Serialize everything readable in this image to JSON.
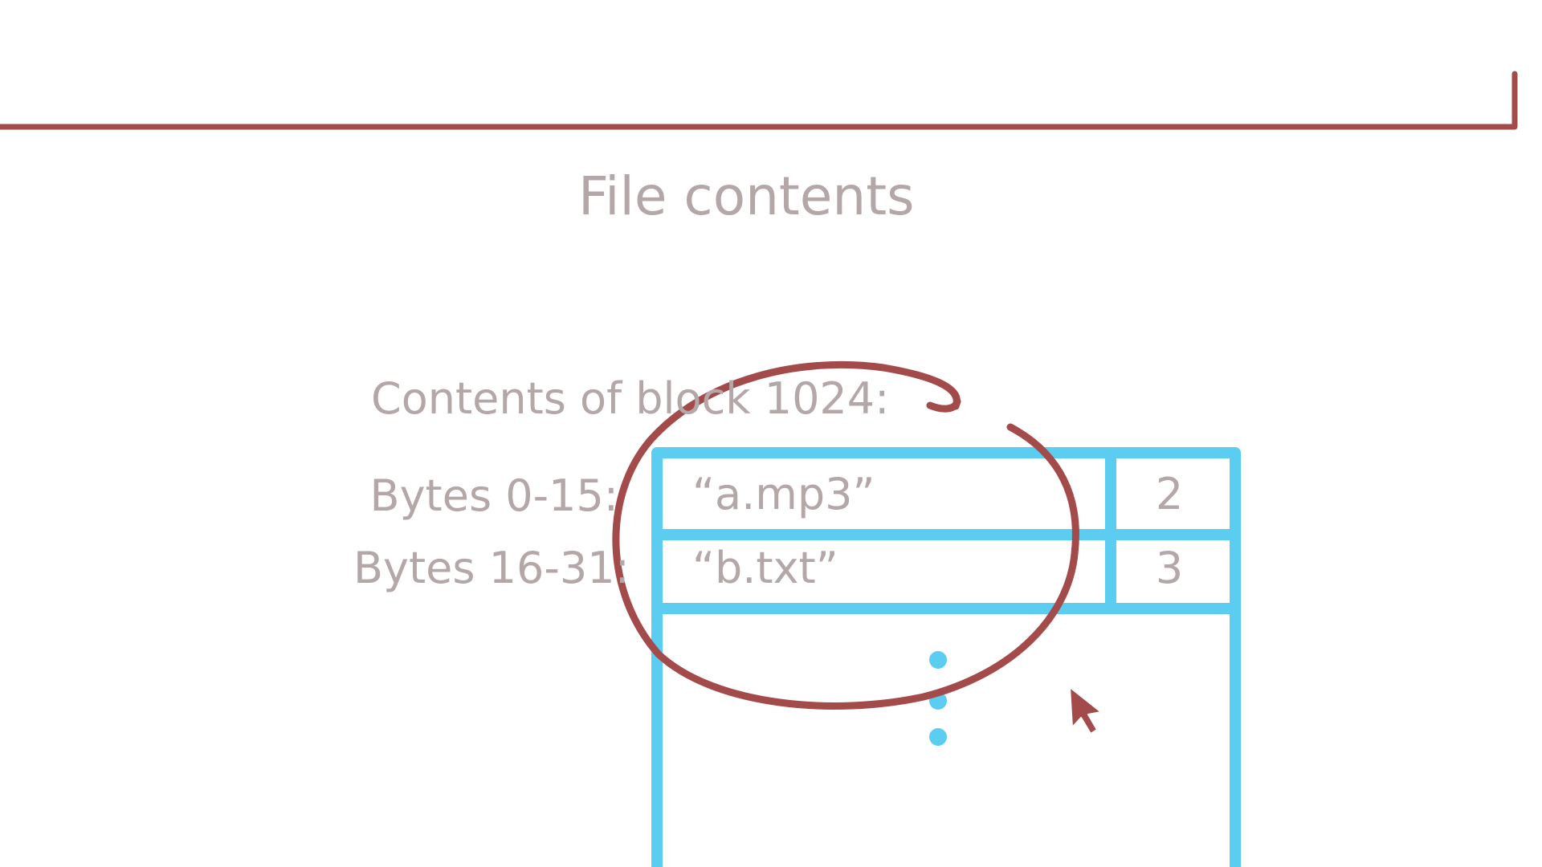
{
  "title": "File contents",
  "block_label": "Contents of block 1024:",
  "rows": [
    {
      "label": "Bytes 0-15:",
      "name": "“a.mp3”",
      "inode": "2"
    },
    {
      "label": "Bytes 16-31:",
      "name": "“b.txt”",
      "inode": "3"
    }
  ],
  "colors": {
    "text": "#b3a7a7",
    "table": "#5bcdf0",
    "annotation": "#a34a4a"
  },
  "icons": [
    "cursor-arrow-icon",
    "ellipsis-dots-icon"
  ]
}
